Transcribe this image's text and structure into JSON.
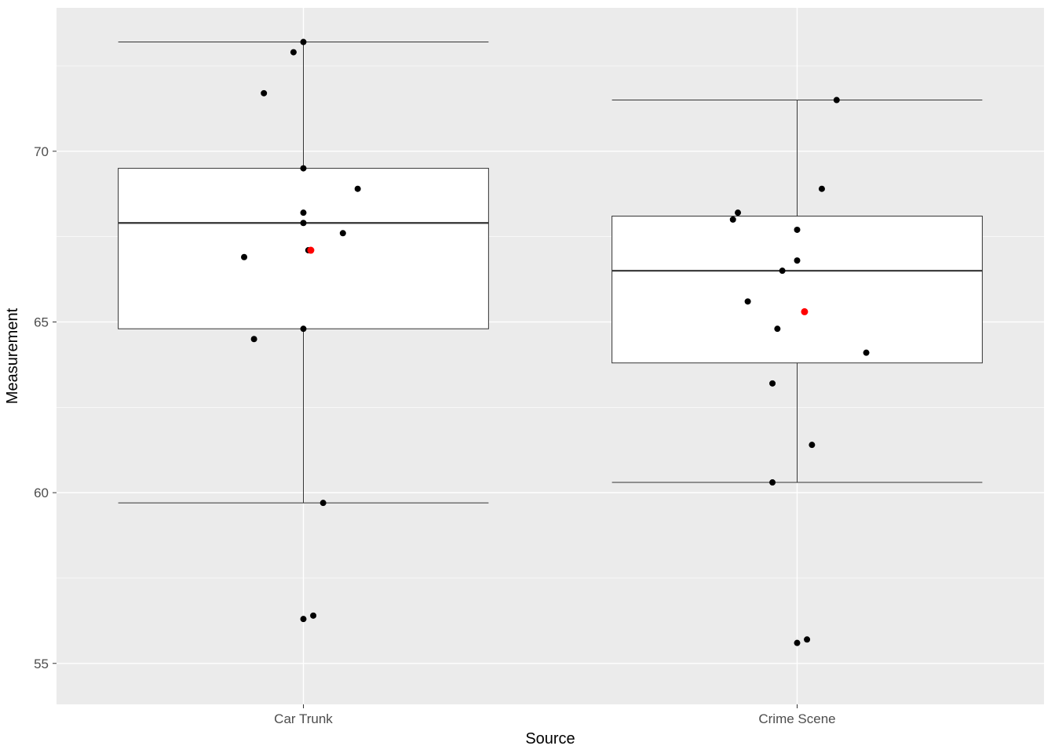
{
  "chart_data": {
    "type": "boxplot",
    "xlabel": "Source",
    "ylabel": "Measurement",
    "categories": [
      "Car Trunk",
      "Crime Scene"
    ],
    "y_ticks": [
      55,
      60,
      65,
      70
    ],
    "ylim": [
      53.8,
      74.2
    ],
    "series": [
      {
        "name": "Car Trunk",
        "box": {
          "min": 59.7,
          "q1": 64.8,
          "median": 67.9,
          "q3": 69.5,
          "max": 73.2
        },
        "mean": 67.1,
        "points": [
          56.3,
          56.4,
          59.7,
          64.5,
          64.8,
          66.9,
          67.1,
          67.6,
          67.9,
          68.2,
          68.9,
          69.5,
          71.7,
          72.9,
          73.2
        ]
      },
      {
        "name": "Crime Scene",
        "box": {
          "min": 60.3,
          "q1": 63.8,
          "median": 66.5,
          "q3": 68.1,
          "max": 71.5
        },
        "mean": 65.3,
        "points": [
          55.6,
          55.7,
          60.3,
          61.4,
          63.2,
          64.1,
          64.8,
          65.6,
          66.5,
          66.8,
          67.7,
          68.0,
          68.2,
          68.9,
          71.5
        ]
      }
    ],
    "jitter": {
      "Car Trunk": [
        0.0,
        0.02,
        0.04,
        -0.1,
        0.0,
        -0.12,
        0.01,
        0.08,
        0.0,
        0.0,
        0.11,
        0.0,
        -0.08,
        -0.02,
        0.0
      ],
      "Crime Scene": [
        0.0,
        0.02,
        -0.05,
        0.03,
        -0.05,
        0.14,
        -0.04,
        -0.1,
        -0.03,
        0.0,
        0.0,
        -0.13,
        -0.12,
        0.05,
        0.08
      ]
    }
  },
  "labels": {
    "xlabel": "Source",
    "ylabel": "Measurement",
    "cat0": "Car Trunk",
    "cat1": "Crime Scene",
    "yt55": "55",
    "yt60": "60",
    "yt65": "65",
    "yt70": "70"
  }
}
